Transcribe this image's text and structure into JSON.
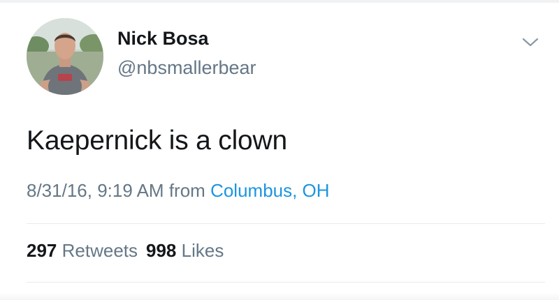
{
  "tweet": {
    "author": {
      "display_name": "Nick Bosa",
      "handle": "@nbsmallerbear",
      "avatar_icon": "profile-photo"
    },
    "menu_icon": "chevron-down-icon",
    "text": "Kaepernick is a clown",
    "timestamp": "8/31/16, 9:19 AM",
    "from_word": "from",
    "location": "Columbus, OH",
    "stats": {
      "retweets_count": "297",
      "retweets_label": "Retweets",
      "likes_count": "998",
      "likes_label": "Likes"
    }
  },
  "colors": {
    "text_primary": "#14171a",
    "text_secondary": "#657786",
    "link": "#1b95e0",
    "divider": "#e6ecf0"
  }
}
